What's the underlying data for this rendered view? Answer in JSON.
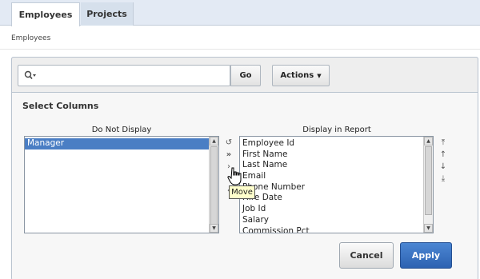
{
  "tabs": [
    {
      "label": "Employees",
      "active": true
    },
    {
      "label": "Projects",
      "active": false
    }
  ],
  "breadcrumb": "Employees",
  "search": {
    "value": "",
    "placeholder": "",
    "go_label": "Go",
    "actions_label": "Actions"
  },
  "dialog": {
    "title": "Select Columns",
    "left_header": "Do Not Display",
    "right_header": "Display in Report",
    "left_items": [
      "Manager"
    ],
    "left_selected": "Manager",
    "right_items": [
      "Employee Id",
      "First Name",
      "Last Name",
      "Email",
      "Phone Number",
      "Hire Date",
      "Job Id",
      "Salary",
      "Commission Pct"
    ],
    "tooltip": "Move",
    "cancel_label": "Cancel",
    "apply_label": "Apply"
  },
  "colors": {
    "tab_bg": "#e3eaf4",
    "selected": "#4a7ec4",
    "apply": "#2d62b1",
    "tooltip": "#ffffcc"
  }
}
